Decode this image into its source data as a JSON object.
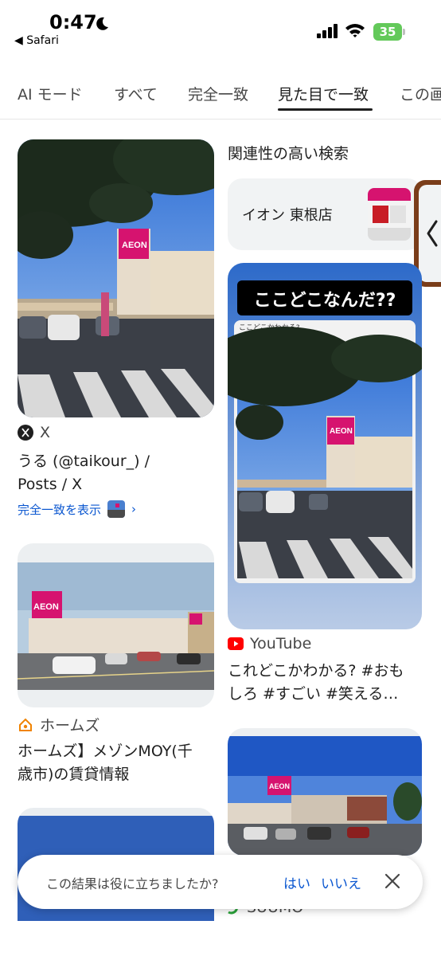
{
  "status_bar": {
    "time": "0:47",
    "back_app": "◀ Safari",
    "battery": "35"
  },
  "tabs": [
    {
      "label": "AI モード"
    },
    {
      "label": "すべて"
    },
    {
      "label": "完全一致"
    },
    {
      "label": "見た目で一致",
      "active": true
    },
    {
      "label": "この画"
    }
  ],
  "results_left": [
    {
      "source": "X",
      "title_line1": "うる (@taikour_) /",
      "title_line2": "Posts / X",
      "match_link": "完全一致を表示",
      "match_chevron": "›"
    },
    {
      "source": "ホームズ",
      "title_line1": "ホームズ】メゾンMOY(千",
      "title_line2": "歳市)の賃貸情報"
    },
    {
      "source": "SUUMO"
    }
  ],
  "related": {
    "heading": "関連性の高い検索",
    "chip_label": "イオン 東根店"
  },
  "results_right": [
    {
      "overlay_title": "ここどこなんだ??",
      "overlay_caption": "ここどこかわかる?",
      "source": "YouTube",
      "title_line1": "これどこかわかる? #おも",
      "title_line2": "しろ #すごい #笑える…"
    }
  ],
  "feedback": {
    "question": "この結果は役に立ちましたか?",
    "yes": "はい",
    "no": "いいえ"
  },
  "colors": {
    "link_blue": "#0b57d0",
    "aeon_pink": "#d6136f",
    "youtube_red": "#ff0000",
    "homes_orange": "#f08300",
    "suumo_green": "#2aa33a"
  },
  "icons": [
    "moon-icon",
    "signal-icon",
    "wifi-icon",
    "battery-icon",
    "x-logo-icon",
    "youtube-icon",
    "homes-icon",
    "suumo-icon",
    "close-icon",
    "chevron-left-icon"
  ]
}
